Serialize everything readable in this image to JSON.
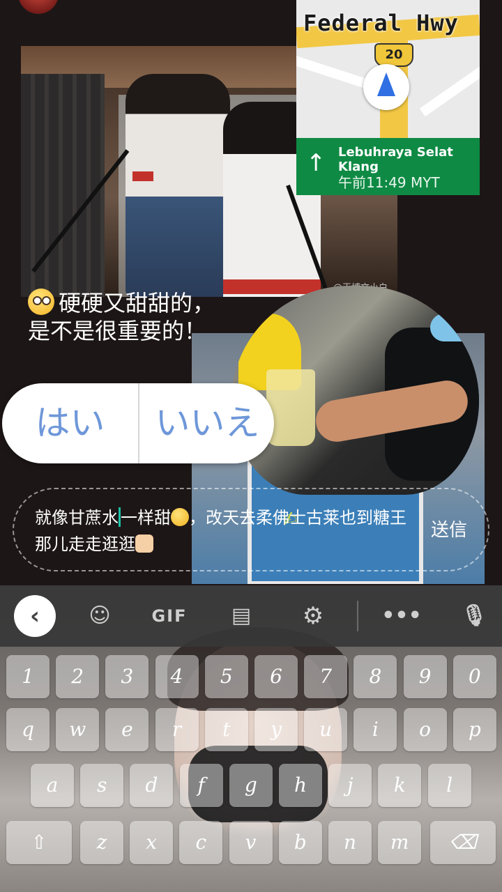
{
  "map": {
    "road_name": "Federal Hwy",
    "route_number": "20",
    "next_street": "Lebuhraya Selat Klang",
    "arrival_time": "午前11:49 MYT"
  },
  "photo": {
    "watermark": "@王博文小白"
  },
  "caption": {
    "line1": "硬硬又甜甜的，",
    "line2": "是不是很重要的！"
  },
  "choices": {
    "yes": "はい",
    "no": "いいえ"
  },
  "compose": {
    "text_part1": "就像甘蔗水",
    "text_part2": "一样甜",
    "text_part3": "，改天去柔佛士古莱也到糖王那儿走走逛逛",
    "send_label": "送信"
  },
  "keyboard": {
    "toolbar": {
      "back_icon": "‹",
      "sticker_icon": "☺",
      "gif_label": "GIF",
      "clipboard_icon": "▤",
      "settings_icon": "⚙",
      "more_icon": "•••",
      "mic_icon": "🎙"
    },
    "row_numbers": [
      "1",
      "2",
      "3",
      "4",
      "5",
      "6",
      "7",
      "8",
      "9",
      "0"
    ],
    "row_top": [
      "q",
      "w",
      "e",
      "r",
      "t",
      "y",
      "u",
      "i",
      "o",
      "p"
    ],
    "row_middle": [
      "a",
      "s",
      "d",
      "f",
      "g",
      "h",
      "j",
      "k",
      "l"
    ],
    "row_bottom": [
      "z",
      "x",
      "c",
      "v",
      "b",
      "n",
      "m"
    ],
    "shift_icon": "⇧",
    "backspace_icon": "⌫"
  },
  "colors": {
    "choice_text": "#6e97d9",
    "nav_banner": "#0f8a44",
    "cursor": "#19c1a6"
  }
}
